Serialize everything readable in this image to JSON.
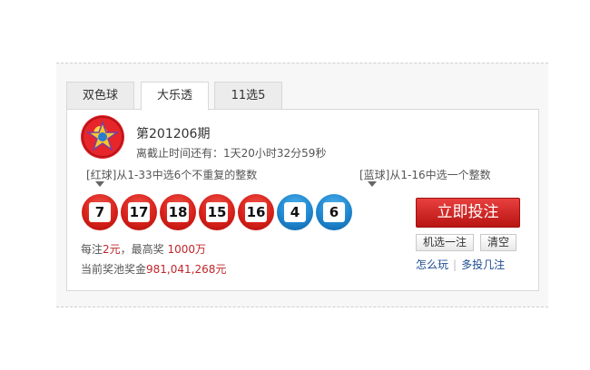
{
  "tabs": [
    {
      "label": "双色球",
      "active": false
    },
    {
      "label": "大乐透",
      "active": true
    },
    {
      "label": "11选5",
      "active": false
    }
  ],
  "lottery": {
    "logo_icon": "lottery-star-logo",
    "issue": "第201206期",
    "deadline": "离截止时间还有：1天20小时32分59秒"
  },
  "hints": {
    "red": "[红球]从1-33中选6个不重复的整数",
    "blue": "[蓝球]从1-16中选一个整数"
  },
  "balls": {
    "red": [
      "7",
      "17",
      "18",
      "15",
      "16"
    ],
    "blue": [
      "4",
      "6"
    ]
  },
  "info": {
    "price_prefix": "每注",
    "price_value": "2元",
    "price_mid": "，最高奖 ",
    "top_prize": "1000万",
    "pool_label": "当前奖池奖金",
    "pool_value": "981,041,268元"
  },
  "actions": {
    "bet_label": "立即投注",
    "random_label": "机选一注",
    "clear_label": "清空",
    "how_to_play": "怎么玩",
    "multi_bet": "多投几注"
  },
  "colors": {
    "red_ball": "#d8211b",
    "blue_ball": "#1f86cf",
    "highlight_text": "#c0262a",
    "link": "#1b4a8e"
  }
}
